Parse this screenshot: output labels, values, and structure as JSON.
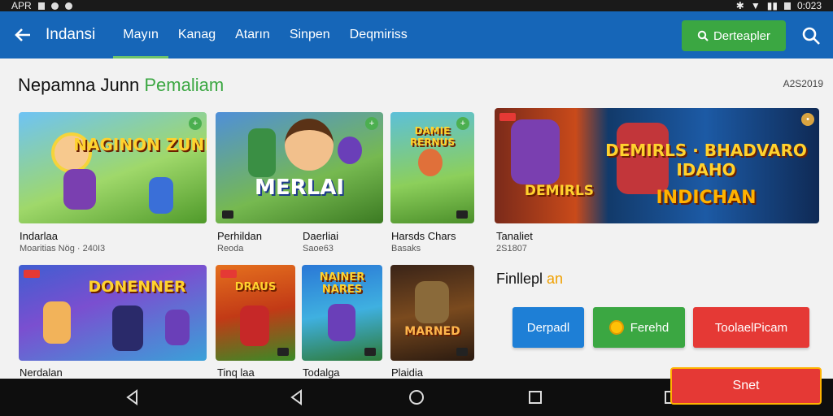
{
  "status_bar": {
    "left_text": "APR",
    "right_text": "0:023"
  },
  "app_bar": {
    "title": "Indansi",
    "tabs": [
      {
        "label": "Mayın",
        "active": true
      },
      {
        "label": "Kanag",
        "active": false
      },
      {
        "label": "Atarın",
        "active": false
      },
      {
        "label": "Sinpen",
        "active": false
      },
      {
        "label": "Deqmiriss",
        "active": false
      }
    ],
    "search_button": "Derteapler",
    "icons": {
      "back": "arrow-left-icon",
      "search": "search-icon"
    }
  },
  "section": {
    "title_main": "Nepamna Junn",
    "title_accent": "Pemaliam",
    "count": "A2S2019"
  },
  "games": [
    {
      "art_text": "NAGINON ZUNK",
      "title": "Indarlaa",
      "subtitle": "Moaritias Nög · 240I3"
    },
    {
      "art_text": "MERLAI",
      "title": "Perhildan",
      "subtitle": "Reoda"
    },
    {
      "art_text": "DAMIE RERNUS",
      "title": "Daerliai",
      "subtitle": "Saoe63"
    },
    {
      "art_text": "DEMIRLS · BHADVARO IDAHO",
      "title": "Tanaliet",
      "subtitle": "2S1807"
    },
    {
      "art_text": "DONENNER",
      "title": "Nerdalan",
      "subtitle": ""
    },
    {
      "art_text": "DRAUS",
      "title": "Tinq laa",
      "subtitle": ""
    },
    {
      "art_text": "NAINER NARES",
      "title": "Todalga",
      "subtitle": ""
    },
    {
      "art_text": "MARNED",
      "title": "Plaidia",
      "subtitle": ""
    }
  ],
  "side_panel": {
    "label_main": "Finllepl",
    "label_accent": "an",
    "buttons": [
      {
        "label": "Derpadl",
        "color": "#1e7fd6"
      },
      {
        "label": "Ferehd",
        "color": "#3ba742"
      },
      {
        "label": "ToolaelPicam",
        "color": "#e53935"
      }
    ]
  },
  "start_button": "Snet",
  "colors": {
    "app_bar": "#1666b8",
    "accent_green": "#3ba742",
    "accent_red": "#e53935",
    "nav_bar": "#0e0e0e"
  }
}
